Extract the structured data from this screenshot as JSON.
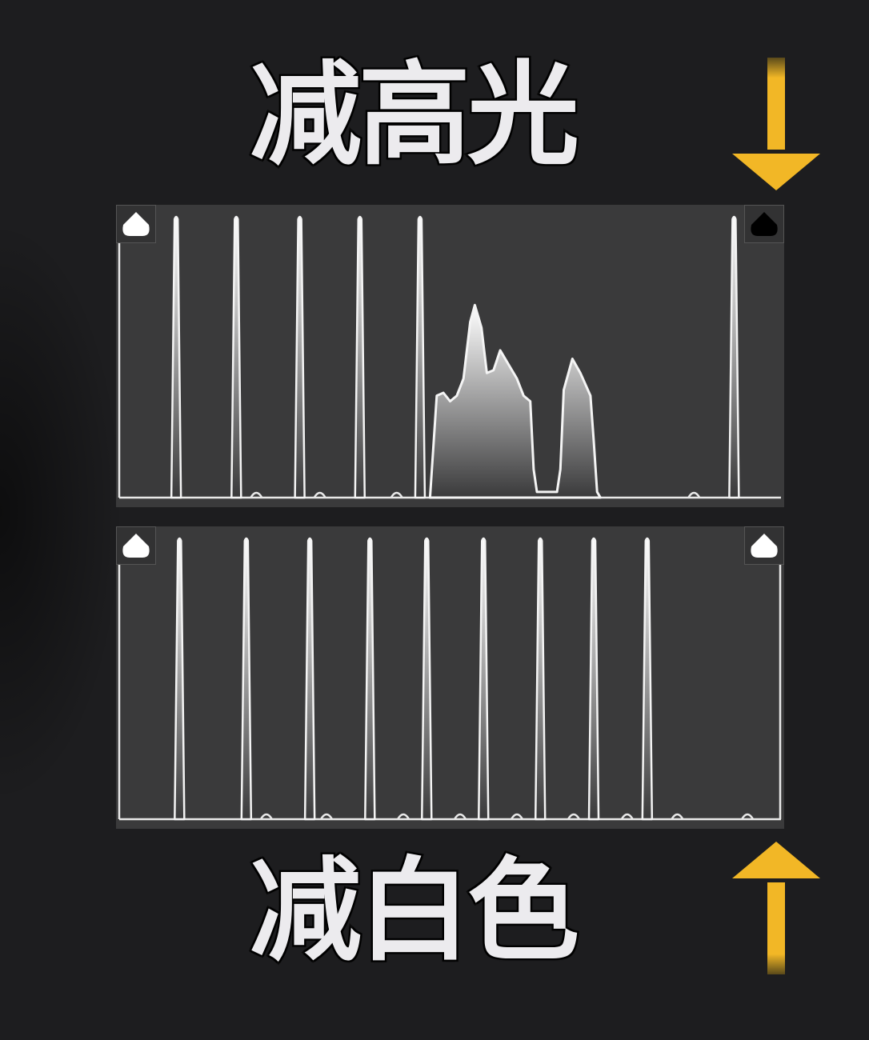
{
  "captions": {
    "top": "减高光",
    "bottom": "减白色"
  },
  "colors": {
    "background": "#1d1d1f",
    "histogram_bg": "#3a3a3b",
    "curve": "#f2f2f2",
    "arrow": "#f2b726",
    "caption_fill": "#ecebee"
  },
  "icons": {
    "top_arrow": "arrow-down-icon",
    "bottom_arrow": "arrow-up-icon",
    "shadow_clip": "shadow-clipping-indicator-icon",
    "highlight_clip": "highlight-clipping-indicator-icon"
  },
  "histograms": {
    "top": {
      "shadow_clip_state": "white",
      "highlight_clip_state": "black",
      "spike_positions": [
        0.09,
        0.18,
        0.275,
        0.365,
        0.455,
        0.925
      ],
      "small_bumps": [
        0.21,
        0.305,
        0.42,
        0.865
      ],
      "mountain": [
        [
          0.47,
          0
        ],
        [
          0.48,
          0.36
        ],
        [
          0.49,
          0.37
        ],
        [
          0.5,
          0.34
        ],
        [
          0.51,
          0.36
        ],
        [
          0.52,
          0.42
        ],
        [
          0.53,
          0.62
        ],
        [
          0.537,
          0.68
        ],
        [
          0.547,
          0.6
        ],
        [
          0.555,
          0.44
        ],
        [
          0.565,
          0.45
        ],
        [
          0.575,
          0.52
        ],
        [
          0.585,
          0.48
        ],
        [
          0.6,
          0.42
        ],
        [
          0.61,
          0.36
        ],
        [
          0.62,
          0.34
        ],
        [
          0.625,
          0.1
        ],
        [
          0.63,
          0.02
        ],
        [
          0.66,
          0.02
        ],
        [
          0.665,
          0.1
        ],
        [
          0.67,
          0.38
        ],
        [
          0.683,
          0.49
        ],
        [
          0.695,
          0.44
        ],
        [
          0.71,
          0.36
        ],
        [
          0.715,
          0.2
        ],
        [
          0.72,
          0.02
        ],
        [
          0.725,
          0
        ]
      ]
    },
    "bottom": {
      "shadow_clip_state": "white",
      "highlight_clip_state": "white",
      "spike_positions": [
        0.095,
        0.195,
        0.29,
        0.38,
        0.465,
        0.55,
        0.635,
        0.715,
        0.795
      ],
      "small_bumps": [
        0.225,
        0.315,
        0.43,
        0.515,
        0.6,
        0.685,
        0.765,
        0.84,
        0.945
      ]
    }
  }
}
